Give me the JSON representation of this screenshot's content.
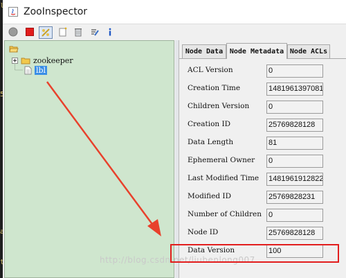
{
  "window": {
    "title": "ZooInspector"
  },
  "toolbar": {
    "buttons": [
      {
        "name": "connect-icon"
      },
      {
        "name": "disconnect-icon"
      },
      {
        "name": "refresh-icon"
      },
      {
        "name": "add-node-icon"
      },
      {
        "name": "delete-node-icon"
      },
      {
        "name": "edit-icon"
      },
      {
        "name": "info-icon"
      }
    ]
  },
  "tree": {
    "nodes": [
      {
        "label": "zookeeper"
      },
      {
        "label": "lbl"
      }
    ]
  },
  "tabs": [
    {
      "label": "Node Data"
    },
    {
      "label": "Node Metadata"
    },
    {
      "label": "Node ACLs"
    }
  ],
  "metadata": {
    "fields": [
      {
        "label": "ACL Version",
        "value": "0"
      },
      {
        "label": "Creation Time",
        "value": "1481961397081"
      },
      {
        "label": "Children Version",
        "value": "0"
      },
      {
        "label": "Creation ID",
        "value": "25769828128"
      },
      {
        "label": "Data Length",
        "value": "81"
      },
      {
        "label": "Ephemeral Owner",
        "value": "0"
      },
      {
        "label": "Last Modified Time",
        "value": "1481961912822"
      },
      {
        "label": "Modified ID",
        "value": "25769828231"
      },
      {
        "label": "Number of Children",
        "value": "0"
      },
      {
        "label": "Node ID",
        "value": "25769828128"
      },
      {
        "label": "Data Version",
        "value": "100"
      }
    ]
  },
  "watermark": "http://blog.csdn.net/liubenlong007",
  "colors": {
    "tree_bg": "#cfe6ce",
    "selection": "#3a8ee6",
    "annotation": "#e21d1d"
  }
}
